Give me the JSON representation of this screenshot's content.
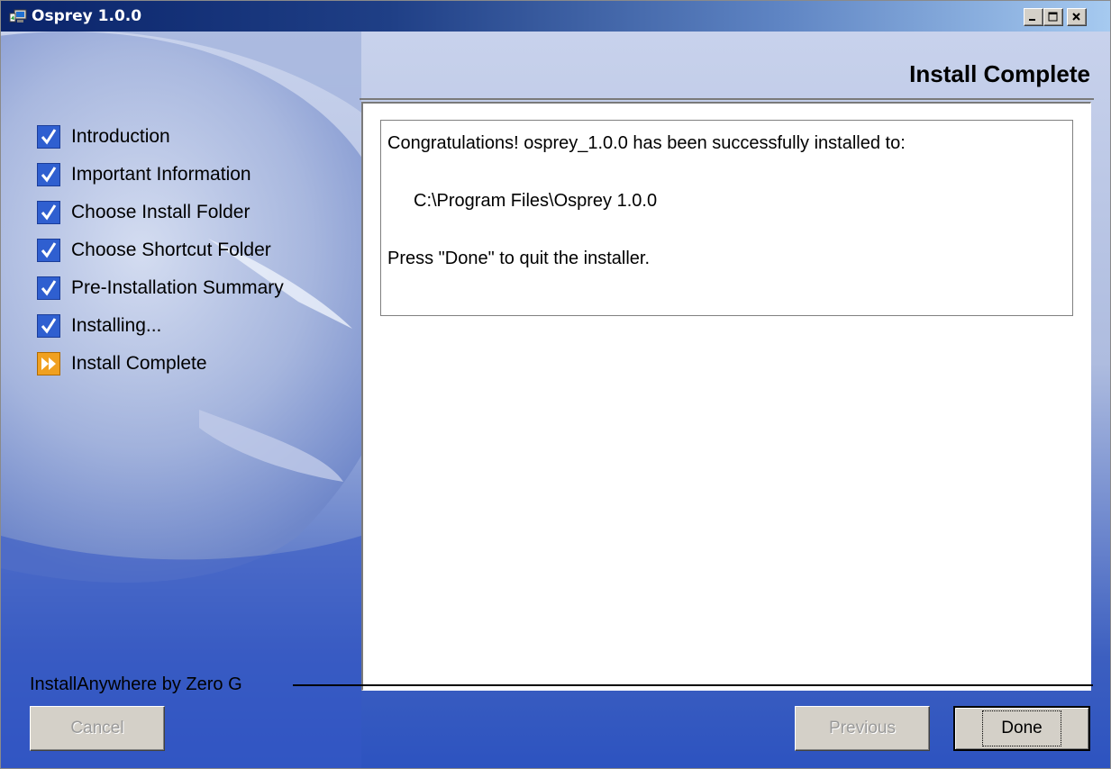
{
  "window": {
    "title": "Osprey 1.0.0",
    "controls": [
      "minimize-icon",
      "maximize-icon",
      "close-icon"
    ]
  },
  "header": {
    "title": "Install Complete"
  },
  "steps": [
    {
      "label": "Introduction",
      "status": "done",
      "icon": "checkmark-icon"
    },
    {
      "label": "Important Information",
      "status": "done",
      "icon": "checkmark-icon"
    },
    {
      "label": "Choose Install Folder",
      "status": "done",
      "icon": "checkmark-icon"
    },
    {
      "label": "Choose Shortcut Folder",
      "status": "done",
      "icon": "checkmark-icon"
    },
    {
      "label": "Pre-Installation Summary",
      "status": "done",
      "icon": "checkmark-icon"
    },
    {
      "label": "Installing...",
      "status": "done",
      "icon": "checkmark-icon"
    },
    {
      "label": "Install Complete",
      "status": "current",
      "icon": "fast-forward-icon"
    }
  ],
  "message": {
    "line1": "Congratulations! osprey_1.0.0 has been successfully installed to:",
    "path": "C:\\Program Files\\Osprey 1.0.0",
    "line3": "Press \"Done\" to quit the installer."
  },
  "footer": {
    "brand": "InstallAnywhere by Zero G",
    "cancel_label": "Cancel",
    "previous_label": "Previous",
    "done_label": "Done"
  },
  "colors": {
    "check_blue": "#2f5fd0",
    "current_orange": "#f0a020",
    "titlebar_dark": "#0a246a"
  }
}
